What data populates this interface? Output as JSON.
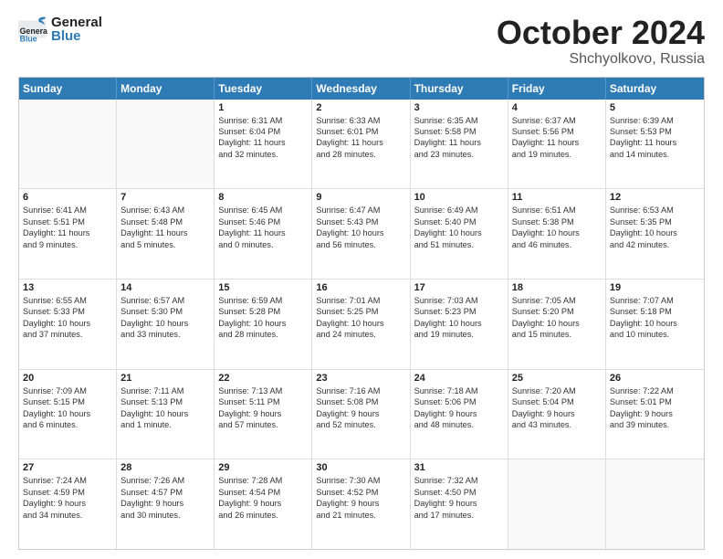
{
  "header": {
    "logo_general": "General",
    "logo_blue": "Blue",
    "month": "October 2024",
    "location": "Shchyolkovo, Russia"
  },
  "days_of_week": [
    "Sunday",
    "Monday",
    "Tuesday",
    "Wednesday",
    "Thursday",
    "Friday",
    "Saturday"
  ],
  "weeks": [
    [
      {
        "day": "",
        "info": [],
        "empty": true
      },
      {
        "day": "",
        "info": [],
        "empty": true
      },
      {
        "day": "1",
        "info": [
          "Sunrise: 6:31 AM",
          "Sunset: 6:04 PM",
          "Daylight: 11 hours",
          "and 32 minutes."
        ]
      },
      {
        "day": "2",
        "info": [
          "Sunrise: 6:33 AM",
          "Sunset: 6:01 PM",
          "Daylight: 11 hours",
          "and 28 minutes."
        ]
      },
      {
        "day": "3",
        "info": [
          "Sunrise: 6:35 AM",
          "Sunset: 5:58 PM",
          "Daylight: 11 hours",
          "and 23 minutes."
        ]
      },
      {
        "day": "4",
        "info": [
          "Sunrise: 6:37 AM",
          "Sunset: 5:56 PM",
          "Daylight: 11 hours",
          "and 19 minutes."
        ]
      },
      {
        "day": "5",
        "info": [
          "Sunrise: 6:39 AM",
          "Sunset: 5:53 PM",
          "Daylight: 11 hours",
          "and 14 minutes."
        ]
      }
    ],
    [
      {
        "day": "6",
        "info": [
          "Sunrise: 6:41 AM",
          "Sunset: 5:51 PM",
          "Daylight: 11 hours",
          "and 9 minutes."
        ]
      },
      {
        "day": "7",
        "info": [
          "Sunrise: 6:43 AM",
          "Sunset: 5:48 PM",
          "Daylight: 11 hours",
          "and 5 minutes."
        ]
      },
      {
        "day": "8",
        "info": [
          "Sunrise: 6:45 AM",
          "Sunset: 5:46 PM",
          "Daylight: 11 hours",
          "and 0 minutes."
        ]
      },
      {
        "day": "9",
        "info": [
          "Sunrise: 6:47 AM",
          "Sunset: 5:43 PM",
          "Daylight: 10 hours",
          "and 56 minutes."
        ]
      },
      {
        "day": "10",
        "info": [
          "Sunrise: 6:49 AM",
          "Sunset: 5:40 PM",
          "Daylight: 10 hours",
          "and 51 minutes."
        ]
      },
      {
        "day": "11",
        "info": [
          "Sunrise: 6:51 AM",
          "Sunset: 5:38 PM",
          "Daylight: 10 hours",
          "and 46 minutes."
        ]
      },
      {
        "day": "12",
        "info": [
          "Sunrise: 6:53 AM",
          "Sunset: 5:35 PM",
          "Daylight: 10 hours",
          "and 42 minutes."
        ]
      }
    ],
    [
      {
        "day": "13",
        "info": [
          "Sunrise: 6:55 AM",
          "Sunset: 5:33 PM",
          "Daylight: 10 hours",
          "and 37 minutes."
        ]
      },
      {
        "day": "14",
        "info": [
          "Sunrise: 6:57 AM",
          "Sunset: 5:30 PM",
          "Daylight: 10 hours",
          "and 33 minutes."
        ]
      },
      {
        "day": "15",
        "info": [
          "Sunrise: 6:59 AM",
          "Sunset: 5:28 PM",
          "Daylight: 10 hours",
          "and 28 minutes."
        ]
      },
      {
        "day": "16",
        "info": [
          "Sunrise: 7:01 AM",
          "Sunset: 5:25 PM",
          "Daylight: 10 hours",
          "and 24 minutes."
        ]
      },
      {
        "day": "17",
        "info": [
          "Sunrise: 7:03 AM",
          "Sunset: 5:23 PM",
          "Daylight: 10 hours",
          "and 19 minutes."
        ]
      },
      {
        "day": "18",
        "info": [
          "Sunrise: 7:05 AM",
          "Sunset: 5:20 PM",
          "Daylight: 10 hours",
          "and 15 minutes."
        ]
      },
      {
        "day": "19",
        "info": [
          "Sunrise: 7:07 AM",
          "Sunset: 5:18 PM",
          "Daylight: 10 hours",
          "and 10 minutes."
        ]
      }
    ],
    [
      {
        "day": "20",
        "info": [
          "Sunrise: 7:09 AM",
          "Sunset: 5:15 PM",
          "Daylight: 10 hours",
          "and 6 minutes."
        ]
      },
      {
        "day": "21",
        "info": [
          "Sunrise: 7:11 AM",
          "Sunset: 5:13 PM",
          "Daylight: 10 hours",
          "and 1 minute."
        ]
      },
      {
        "day": "22",
        "info": [
          "Sunrise: 7:13 AM",
          "Sunset: 5:11 PM",
          "Daylight: 9 hours",
          "and 57 minutes."
        ]
      },
      {
        "day": "23",
        "info": [
          "Sunrise: 7:16 AM",
          "Sunset: 5:08 PM",
          "Daylight: 9 hours",
          "and 52 minutes."
        ]
      },
      {
        "day": "24",
        "info": [
          "Sunrise: 7:18 AM",
          "Sunset: 5:06 PM",
          "Daylight: 9 hours",
          "and 48 minutes."
        ]
      },
      {
        "day": "25",
        "info": [
          "Sunrise: 7:20 AM",
          "Sunset: 5:04 PM",
          "Daylight: 9 hours",
          "and 43 minutes."
        ]
      },
      {
        "day": "26",
        "info": [
          "Sunrise: 7:22 AM",
          "Sunset: 5:01 PM",
          "Daylight: 9 hours",
          "and 39 minutes."
        ]
      }
    ],
    [
      {
        "day": "27",
        "info": [
          "Sunrise: 7:24 AM",
          "Sunset: 4:59 PM",
          "Daylight: 9 hours",
          "and 34 minutes."
        ]
      },
      {
        "day": "28",
        "info": [
          "Sunrise: 7:26 AM",
          "Sunset: 4:57 PM",
          "Daylight: 9 hours",
          "and 30 minutes."
        ]
      },
      {
        "day": "29",
        "info": [
          "Sunrise: 7:28 AM",
          "Sunset: 4:54 PM",
          "Daylight: 9 hours",
          "and 26 minutes."
        ]
      },
      {
        "day": "30",
        "info": [
          "Sunrise: 7:30 AM",
          "Sunset: 4:52 PM",
          "Daylight: 9 hours",
          "and 21 minutes."
        ]
      },
      {
        "day": "31",
        "info": [
          "Sunrise: 7:32 AM",
          "Sunset: 4:50 PM",
          "Daylight: 9 hours",
          "and 17 minutes."
        ]
      },
      {
        "day": "",
        "info": [],
        "empty": true
      },
      {
        "day": "",
        "info": [],
        "empty": true
      }
    ]
  ]
}
